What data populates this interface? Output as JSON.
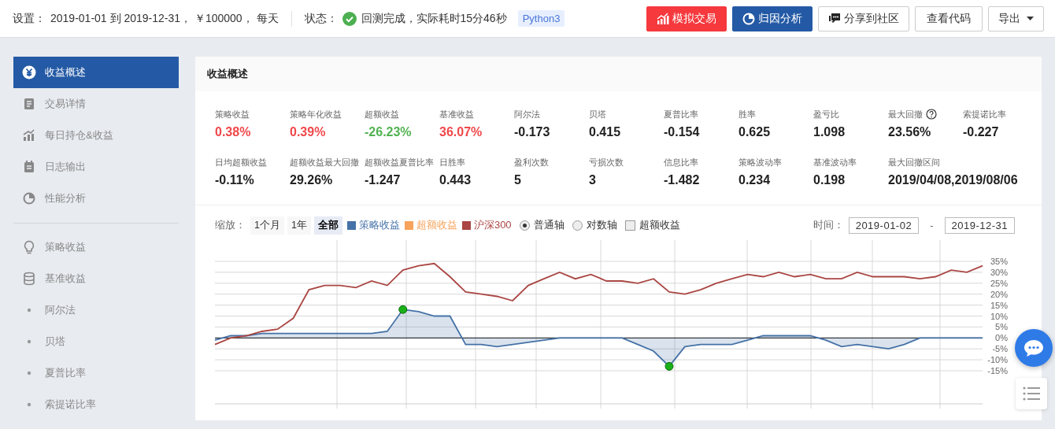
{
  "top_bar": {
    "settings_label": "设置：",
    "settings_value": "2019-01-01 到 2019-12-31， ￥100000， 每天",
    "status_label": "状态：",
    "status_text": "回测完成，实际耗时15分46秒",
    "language_badge": "Python3",
    "buttons": [
      {
        "label": "模拟交易",
        "kind": "danger"
      },
      {
        "label": "归因分析",
        "kind": "primary"
      },
      {
        "label": "分享到社区",
        "kind": "share"
      },
      {
        "label": "查看代码",
        "kind": "plain"
      },
      {
        "label": "导出",
        "kind": "dropdown"
      }
    ]
  },
  "sidebar": {
    "items": [
      {
        "label": "收益概述",
        "kind": "icon",
        "selected": true
      },
      {
        "label": "交易详情",
        "kind": "icon",
        "selected": false
      },
      {
        "label": "每日持仓&收益",
        "kind": "icon",
        "selected": false
      },
      {
        "label": "日志输出",
        "kind": "icon",
        "selected": false
      },
      {
        "label": "性能分析",
        "kind": "icon",
        "selected": false
      },
      {
        "label": "策略收益",
        "kind": "icon",
        "selected": false,
        "divider_before": true
      },
      {
        "label": "基准收益",
        "kind": "icon",
        "selected": false
      },
      {
        "label": "阿尔法",
        "kind": "bullet",
        "selected": false
      },
      {
        "label": "贝塔",
        "kind": "bullet",
        "selected": false
      },
      {
        "label": "夏普比率",
        "kind": "bullet",
        "selected": false
      },
      {
        "label": "索提诺比率",
        "kind": "bullet",
        "selected": false
      }
    ]
  },
  "panel": {
    "title": "收益概述",
    "metrics": [
      {
        "label": "策略收益",
        "value": "0.38%",
        "color": "#f0474a"
      },
      {
        "label": "策略年化收益",
        "value": "0.39%",
        "color": "#f0474a"
      },
      {
        "label": "超额收益",
        "value": "-26.23%",
        "color": "#52b252"
      },
      {
        "label": "基准收益",
        "value": "36.07%",
        "color": "#f0474a"
      },
      {
        "label": "阿尔法",
        "value": "-0.173"
      },
      {
        "label": "贝塔",
        "value": "0.415"
      },
      {
        "label": "夏普比率",
        "value": "-0.154"
      },
      {
        "label": "胜率",
        "value": "0.625"
      },
      {
        "label": "盈亏比",
        "value": "1.098"
      },
      {
        "label": "最大回撤",
        "value": "23.56%",
        "help": true
      },
      {
        "label": "索提诺比率",
        "value": "-0.227"
      },
      {
        "label": "日均超额收益",
        "value": "-0.11%"
      },
      {
        "label": "超额收益最大回撤",
        "value": "29.26%"
      },
      {
        "label": "超额收益夏普比率",
        "value": "-1.247"
      },
      {
        "label": "日胜率",
        "value": "0.443"
      },
      {
        "label": "盈利次数",
        "value": "5"
      },
      {
        "label": "亏损次数",
        "value": "3"
      },
      {
        "label": "信息比率",
        "value": "-1.482"
      },
      {
        "label": "策略波动率",
        "value": "0.234"
      },
      {
        "label": "基准波动率",
        "value": "0.198"
      },
      {
        "label": "最大回撤区间",
        "value": "2019/04/08,2019/08/06",
        "wide": true
      }
    ],
    "chart_controls": {
      "zoom_label": "缩放：",
      "zoom_options": [
        {
          "label": "1个月",
          "selected": false
        },
        {
          "label": "1年",
          "selected": false
        },
        {
          "label": "全部",
          "selected": true
        }
      ],
      "axis_options": [
        {
          "label": "普通轴",
          "selected": true
        },
        {
          "label": "对数轴",
          "selected": false
        }
      ],
      "excess_toggle": {
        "label": "超额收益",
        "checked": false
      },
      "time_label": "时间：",
      "date_from": "2019-01-02",
      "date_separator": "-",
      "date_to": "2019-12-31"
    },
    "chart_data": {
      "type": "line",
      "grid": true,
      "ylim": [
        -15,
        35
      ],
      "yticks": [
        {
          "value": 35,
          "label": "35%"
        },
        {
          "value": 30,
          "label": "30%"
        },
        {
          "value": 25,
          "label": "25%"
        },
        {
          "value": 20,
          "label": "20%"
        },
        {
          "value": 15,
          "label": "15%"
        },
        {
          "value": 10,
          "label": "10%"
        },
        {
          "value": 5,
          "label": "5%"
        },
        {
          "value": 0,
          "label": "0%"
        },
        {
          "value": -5,
          "label": "-5%"
        },
        {
          "value": -10,
          "label": "-10%"
        },
        {
          "value": -15,
          "label": "-15%"
        }
      ],
      "series": [
        {
          "name": "策略收益",
          "color": "#4572a7",
          "values": [
            -1,
            1,
            1,
            2,
            2,
            2,
            2,
            2,
            2,
            2,
            2,
            3,
            13,
            12,
            10,
            10,
            -3,
            -3,
            -4,
            -3,
            -2,
            -1,
            0,
            0,
            0,
            0,
            0,
            -3,
            -6,
            -13,
            -4,
            -3,
            -3,
            -3,
            -1,
            1,
            1,
            1,
            1,
            -1,
            -4,
            -3,
            -4,
            -5,
            -3,
            0,
            0,
            0,
            0,
            0
          ]
        },
        {
          "name": "超额收益",
          "color": "#f7a35c",
          "values": [
            null,
            null,
            null,
            null,
            null,
            null,
            null,
            null,
            null,
            null,
            null,
            null,
            null,
            null,
            null,
            null,
            null,
            null,
            null,
            null,
            null,
            null,
            null,
            null,
            null,
            null,
            null,
            null,
            null,
            null,
            null,
            null,
            null,
            null,
            null,
            null,
            null,
            null,
            null,
            null,
            null,
            null,
            null,
            null,
            null,
            null,
            null,
            null,
            null,
            null
          ]
        },
        {
          "name": "沪深300",
          "color": "#aa4643",
          "values": [
            -3,
            0,
            1,
            3,
            4,
            9,
            22,
            24,
            24,
            23,
            26,
            24,
            31,
            33,
            34,
            28,
            21,
            20,
            19,
            17,
            24,
            27,
            30,
            27,
            29,
            26,
            26,
            25,
            27,
            21,
            20,
            22,
            25,
            27,
            29,
            28,
            30,
            28,
            29,
            27,
            27,
            30,
            28,
            28,
            28,
            27,
            28,
            31,
            30,
            33
          ]
        }
      ]
    }
  }
}
